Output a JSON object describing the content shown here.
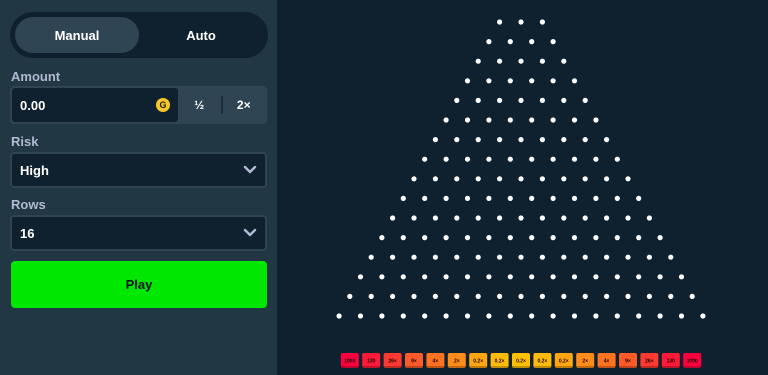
{
  "mode_tabs": [
    "Manual",
    "Auto"
  ],
  "active_mode": "Manual",
  "amount": {
    "label": "Amount",
    "value": "0.00",
    "currency_symbol": "G",
    "half_label": "½",
    "double_label": "2×"
  },
  "risk": {
    "label": "Risk",
    "value": "High"
  },
  "rows": {
    "label": "Rows",
    "value": "16"
  },
  "play_label": "Play",
  "board": {
    "peg_rows": 16,
    "first_row_pegs": 3,
    "multipliers": [
      "1000",
      "130",
      "26×",
      "9×",
      "4×",
      "2×",
      "0.2×",
      "0.2×",
      "0.2×",
      "0.2×",
      "0.2×",
      "2×",
      "4×",
      "9×",
      "26×",
      "130",
      "1000"
    ],
    "bucket_colors": [
      "#ff003f",
      "#ff1a3a",
      "#ff3a30",
      "#ff5a28",
      "#ff7320",
      "#ff8c18",
      "#ffa611",
      "#ffbc0b",
      "#ffc000",
      "#ffbc0b",
      "#ffa611",
      "#ff8c18",
      "#ff7320",
      "#ff5a28",
      "#ff3a30",
      "#ff1a3a",
      "#ff003f"
    ]
  }
}
